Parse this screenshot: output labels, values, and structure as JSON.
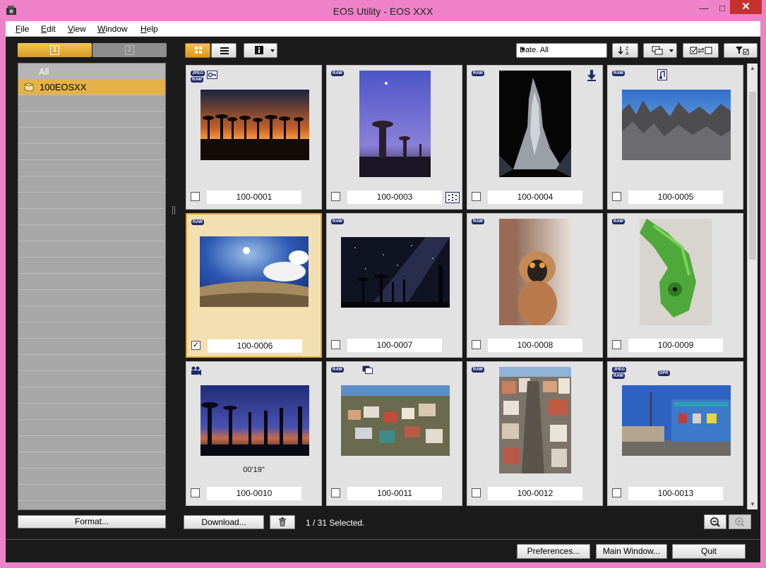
{
  "window": {
    "title": "EOS Utility -  EOS XXX",
    "min_label": "—",
    "max_label": "□",
    "close_label": "✕"
  },
  "menu": [
    "File",
    "Edit",
    "View",
    "Window",
    "Help"
  ],
  "card_tabs": [
    {
      "label": "1",
      "active": true
    },
    {
      "label": "2",
      "active": false
    }
  ],
  "folder_tree": {
    "all_label": "All",
    "folder_label": "100EOSXX"
  },
  "left_buttons": {
    "format": "Format..."
  },
  "toolbar": {
    "grid_icon": "grid-view-icon",
    "list_icon": "list-view-icon",
    "info_icon": "info-icon",
    "sort_value": "Date. All",
    "sort_icon": "sort-az-icon",
    "group_icon": "group-icon",
    "swap_icon": "swap-select-icon",
    "filter_icon": "filter-icon"
  },
  "thumbnails": [
    {
      "name": "100-0001",
      "checked": false,
      "selected": false,
      "badges": [
        "JPEG",
        "RAW"
      ],
      "icons": [
        "protect-key-icon"
      ]
    },
    {
      "name": "100-0003",
      "checked": false,
      "selected": false,
      "badges": [
        "RAW"
      ],
      "icons": [
        "af-point-icon"
      ]
    },
    {
      "name": "100-0004",
      "checked": false,
      "selected": false,
      "badges": [
        "RAW"
      ],
      "icons": [
        "download-arrow-icon"
      ]
    },
    {
      "name": "100-0005",
      "checked": false,
      "selected": false,
      "badges": [
        "RAW"
      ],
      "icons": [
        "sound-memo-icon"
      ]
    },
    {
      "name": "100-0006",
      "checked": true,
      "selected": true,
      "badges": [
        "RAW"
      ],
      "icons": []
    },
    {
      "name": "100-0007",
      "checked": false,
      "selected": false,
      "badges": [
        "RAW"
      ],
      "icons": []
    },
    {
      "name": "100-0008",
      "checked": false,
      "selected": false,
      "badges": [
        "RAW"
      ],
      "icons": []
    },
    {
      "name": "100-0009",
      "checked": false,
      "selected": false,
      "badges": [
        "RAW"
      ],
      "icons": []
    },
    {
      "name": "100-0010",
      "checked": false,
      "selected": false,
      "badges": [],
      "icons": [
        "movie-icon"
      ],
      "duration": "00'19\""
    },
    {
      "name": "100-0011",
      "checked": false,
      "selected": false,
      "badges": [
        "RAW"
      ],
      "icons": [
        "multi-image-icon"
      ]
    },
    {
      "name": "100-0012",
      "checked": false,
      "selected": false,
      "badges": [
        "RAW"
      ],
      "icons": []
    },
    {
      "name": "100-0013",
      "checked": false,
      "selected": false,
      "badges": [
        "JPEG",
        "RAW",
        "DPR"
      ],
      "icons": []
    }
  ],
  "bottom": {
    "download": "Download...",
    "delete_icon": "trash-icon",
    "status": "1 / 31 Selected.",
    "zoom_out_icon": "zoom-out-icon",
    "zoom_in_icon": "zoom-in-icon",
    "preferences": "Preferences...",
    "main_window": "Main Window...",
    "quit": "Quit"
  },
  "colors": {
    "accent": "#e0a838",
    "frame": "#ee82c8",
    "background": "#1b1b1b",
    "badge": "#1c2a6b"
  }
}
